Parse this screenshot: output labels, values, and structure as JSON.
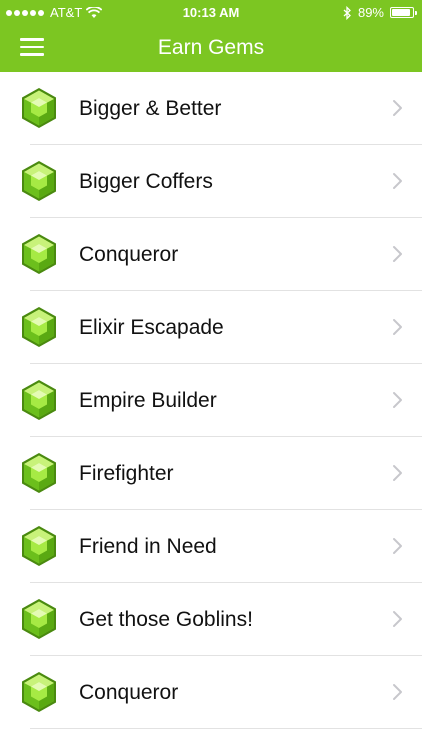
{
  "status_bar": {
    "carrier": "AT&T",
    "time": "10:13 AM",
    "battery": "89%",
    "battery_level": 0.89,
    "icons": [
      "signal-dots-icon",
      "wifi-icon",
      "bluetooth-icon",
      "battery-icon"
    ]
  },
  "header": {
    "title": "Earn Gems",
    "menu_icon": "hamburger-menu-icon"
  },
  "colors": {
    "header_bg": "#7cc622",
    "gem_green": "#7fd320",
    "separator": "#e2e2e2",
    "chevron": "#c7c7cc"
  },
  "items": [
    {
      "label": "Bigger & Better",
      "icon": "gem-icon"
    },
    {
      "label": "Bigger Coffers",
      "icon": "gem-icon"
    },
    {
      "label": "Conqueror",
      "icon": "gem-icon"
    },
    {
      "label": "Elixir Escapade",
      "icon": "gem-icon"
    },
    {
      "label": "Empire Builder",
      "icon": "gem-icon"
    },
    {
      "label": "Firefighter",
      "icon": "gem-icon"
    },
    {
      "label": "Friend in Need",
      "icon": "gem-icon"
    },
    {
      "label": "Get those Goblins!",
      "icon": "gem-icon"
    },
    {
      "label": "Conqueror",
      "icon": "gem-icon"
    }
  ]
}
